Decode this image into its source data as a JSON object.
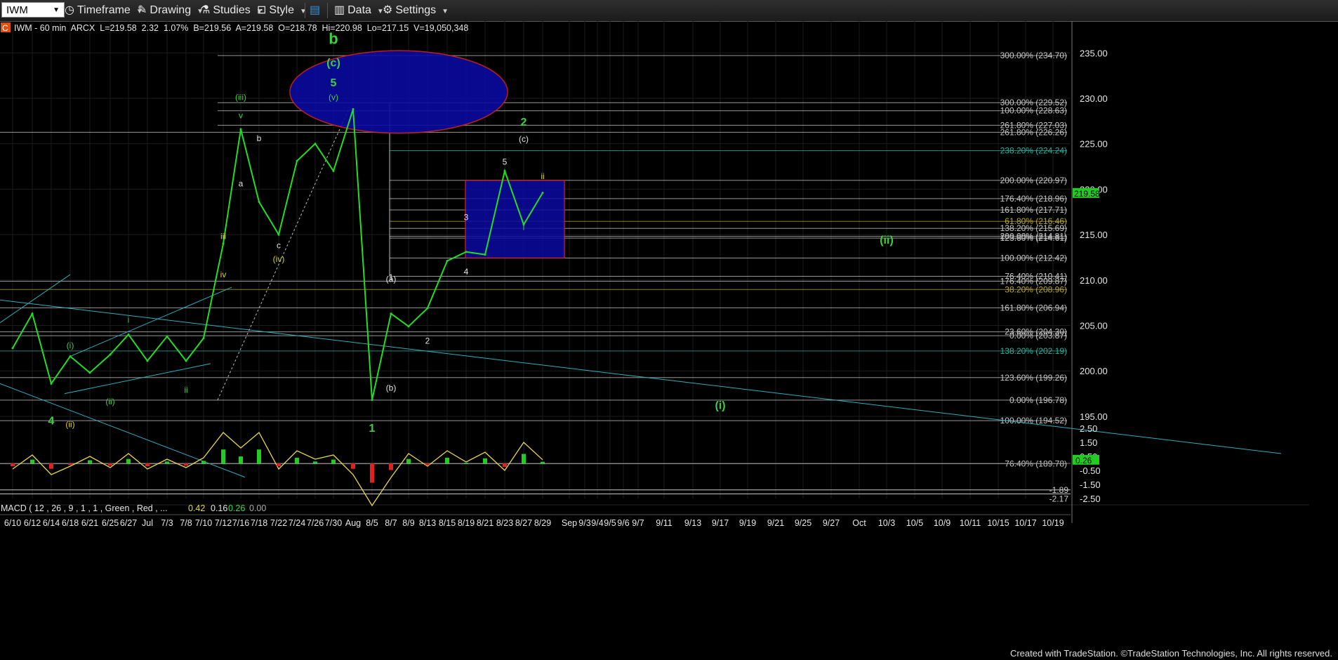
{
  "toolbar": {
    "symbol": "IWM",
    "timeframe": "Timeframe",
    "drawing": "Drawing",
    "studies": "Studies",
    "style": "Style",
    "data": "Data",
    "settings": "Settings"
  },
  "header": {
    "badge": "C",
    "info": "IWM - 60 min  ARCX  L=219.58  2.32  1.07%  B=219.56  A=219.58  O=218.78  Hi=220.98  Lo=217.15  V=19,050,348"
  },
  "macd_header": {
    "label": "MACD ( 12 , 26 , 9 , 1 , 1 , Green , Red , ...",
    "v1": "0.42",
    "v2": "0.16",
    "v3": "0.26",
    "v4": "0.00"
  },
  "footer": "Created with TradeStation. ©TradeStation Technologies, Inc. All rights reserved.",
  "colors": {
    "bg": "#000000",
    "price_line": "#22dd22",
    "wave_green": "#3ecf3e",
    "wave_yellow": "#d8d02a",
    "channel": "#2ab0c0",
    "box": "#0a0aa0",
    "box_border": "#cc2222"
  },
  "chart_data": {
    "type": "line",
    "symbol": "IWM",
    "interval": "60 min",
    "x_ticks": [
      "6/10",
      "6/12",
      "6/14",
      "6/18",
      "6/21",
      "6/25",
      "6/27",
      "Jul",
      "7/3",
      "7/8",
      "7/10",
      "7/12",
      "7/16",
      "7/18",
      "7/22",
      "7/24",
      "7/26",
      "7/30",
      "Aug",
      "8/5",
      "8/7",
      "8/9",
      "8/13",
      "8/15",
      "8/19",
      "8/21",
      "8/23",
      "8/27",
      "8/29",
      "Sep",
      "9/3",
      "9/4",
      "9/5",
      "9/6",
      "9/7",
      "9/11",
      "9/13",
      "9/17",
      "9/19",
      "9/21",
      "9/25",
      "9/27",
      "Oct",
      "10/3",
      "10/5",
      "10/9",
      "10/11",
      "10/15",
      "10/17",
      "10/19"
    ],
    "y_ticks": [
      195,
      200,
      205,
      210,
      215,
      220,
      225,
      230,
      235
    ],
    "ylim": [
      187.5,
      238.5
    ],
    "last_price": "219.58",
    "price_series": [
      {
        "x": "6/10",
        "y": 202.5
      },
      {
        "x": "6/12",
        "y": 206.3
      },
      {
        "x": "6/14",
        "y": 198.6
      },
      {
        "x": "6/18",
        "y": 201.6
      },
      {
        "x": "6/21",
        "y": 199.8
      },
      {
        "x": "6/25",
        "y": 201.8
      },
      {
        "x": "6/27",
        "y": 204.0
      },
      {
        "x": "Jul",
        "y": 201.1
      },
      {
        "x": "7/3",
        "y": 203.8
      },
      {
        "x": "7/8",
        "y": 201.1
      },
      {
        "x": "7/10",
        "y": 203.6
      },
      {
        "x": "7/12",
        "y": 214.0
      },
      {
        "x": "7/16",
        "y": 226.6
      },
      {
        "x": "7/18",
        "y": 218.6
      },
      {
        "x": "7/22",
        "y": 215.0
      },
      {
        "x": "7/24",
        "y": 223.1
      },
      {
        "x": "7/26",
        "y": 225.0
      },
      {
        "x": "7/30",
        "y": 222.0
      },
      {
        "x": "Aug",
        "y": 228.8
      },
      {
        "x": "8/5",
        "y": 196.8
      },
      {
        "x": "8/7",
        "y": 206.3
      },
      {
        "x": "8/9",
        "y": 204.9
      },
      {
        "x": "8/13",
        "y": 206.9
      },
      {
        "x": "8/15",
        "y": 212.1
      },
      {
        "x": "8/19",
        "y": 213.1
      },
      {
        "x": "8/21",
        "y": 212.8
      },
      {
        "x": "8/23",
        "y": 222.0
      },
      {
        "x": "8/27",
        "y": 216.1
      },
      {
        "x": "8/29",
        "y": 219.6
      }
    ],
    "fib_levels": [
      {
        "label": "300.00% (234.70)",
        "value": 234.7
      },
      {
        "label": "300.00% (229.52)",
        "value": 229.52
      },
      {
        "label": "100.00% (228.63)",
        "value": 228.63
      },
      {
        "label": "261.80% (227.03)",
        "value": 227.03
      },
      {
        "label": "261.80% (226.26)",
        "value": 226.26
      },
      {
        "label": "238.20% (224.24)",
        "value": 224.24
      },
      {
        "label": "200.00% (220.97)",
        "value": 220.97
      },
      {
        "label": "176.40% (218.96)",
        "value": 218.96
      },
      {
        "label": "161.80% (217.71)",
        "value": 217.71
      },
      {
        "label": "61.80% (216.46)",
        "value": 216.46
      },
      {
        "label": "138.20% (215.69)",
        "value": 215.69
      },
      {
        "label": "200.00% (214.81)",
        "value": 214.81
      },
      {
        "label": "123.60% (214.61)",
        "value": 214.61
      },
      {
        "label": "100.00% (212.42)",
        "value": 212.42
      },
      {
        "label": "76.40% (210.41)",
        "value": 210.41
      },
      {
        "label": "176.40% (209.87)",
        "value": 209.87
      },
      {
        "label": "38.20% (208.96)",
        "value": 208.96
      },
      {
        "label": "161.80% (206.94)",
        "value": 206.94
      },
      {
        "label": "23.60% (204.30)",
        "value": 204.3
      },
      {
        "label": "0.00% (203.87)",
        "value": 203.87
      },
      {
        "label": "138.20% (202.19)",
        "value": 202.19
      },
      {
        "label": "123.60% (199.26)",
        "value": 199.26
      },
      {
        "label": "0.00% (196.78)",
        "value": 196.78
      },
      {
        "label": "100.00% (194.52)",
        "value": 194.52
      },
      {
        "label": "76.40% (189.78)",
        "value": 189.78
      }
    ],
    "wave_labels": [
      {
        "text": "b",
        "x": "7/30",
        "y": 236.0,
        "color": "green",
        "size": "xl"
      },
      {
        "text": "(c)",
        "x": "7/30",
        "y": 233.5,
        "color": "green",
        "size": "l"
      },
      {
        "text": "5",
        "x": "7/30",
        "y": 231.3,
        "color": "green",
        "size": "l"
      },
      {
        "text": "(v)",
        "x": "7/30",
        "y": 229.8,
        "color": "green",
        "size": "s"
      },
      {
        "text": "(iii)",
        "x": "7/16",
        "y": 229.8,
        "color": "green",
        "size": "s"
      },
      {
        "text": "v",
        "x": "7/16",
        "y": 227.8,
        "color": "green",
        "size": "s"
      },
      {
        "text": "b",
        "x": "7/18",
        "y": 225.3,
        "color": "white",
        "size": "s"
      },
      {
        "text": "a",
        "x": "7/16",
        "y": 220.3,
        "color": "white",
        "size": "s"
      },
      {
        "text": "c",
        "x": "7/22",
        "y": 213.5,
        "color": "white",
        "size": "s"
      },
      {
        "text": "(iv)",
        "x": "7/22",
        "y": 212.0,
        "color": "yellow",
        "size": "s"
      },
      {
        "text": "iii",
        "x": "7/12",
        "y": 214.5,
        "color": "yellow",
        "size": "s"
      },
      {
        "text": "iv",
        "x": "7/12",
        "y": 210.3,
        "color": "yellow",
        "size": "s"
      },
      {
        "text": "(i)",
        "x": "6/18",
        "y": 202.5,
        "color": "green",
        "size": "s"
      },
      {
        "text": "i",
        "x": "6/27",
        "y": 205.3,
        "color": "green",
        "size": "s"
      },
      {
        "text": "(ii)",
        "x": "6/25",
        "y": 196.3,
        "color": "green",
        "size": "s"
      },
      {
        "text": "ii",
        "x": "7/8",
        "y": 197.6,
        "color": "green",
        "size": "s"
      },
      {
        "text": "4",
        "x": "6/14",
        "y": 194.1,
        "color": "green",
        "size": "l"
      },
      {
        "text": "(ii)",
        "x": "6/18",
        "y": 193.8,
        "color": "yellow",
        "size": "s"
      },
      {
        "text": "1",
        "x": "8/5",
        "y": 193.3,
        "color": "green",
        "size": "l"
      },
      {
        "text": "(a)",
        "x": "8/7",
        "y": 209.8,
        "color": "white",
        "size": "s"
      },
      {
        "text": "1",
        "x": "8/7",
        "y": 210.0,
        "color": "white",
        "size": "s"
      },
      {
        "text": "(b)",
        "x": "8/7",
        "y": 197.8,
        "color": "white",
        "size": "s"
      },
      {
        "text": "2",
        "x": "8/13",
        "y": 203.0,
        "color": "white",
        "size": "s"
      },
      {
        "text": "3",
        "x": "8/19",
        "y": 216.6,
        "color": "white",
        "size": "s"
      },
      {
        "text": "4",
        "x": "8/19",
        "y": 210.6,
        "color": "white",
        "size": "s"
      },
      {
        "text": "5",
        "x": "8/23",
        "y": 222.7,
        "color": "white",
        "size": "s"
      },
      {
        "text": "(c)",
        "x": "8/27",
        "y": 225.2,
        "color": "white",
        "size": "s"
      },
      {
        "text": "2",
        "x": "8/27",
        "y": 227.0,
        "color": "green",
        "size": "l"
      },
      {
        "text": "i",
        "x": "8/27",
        "y": 215.5,
        "color": "green",
        "size": "s"
      },
      {
        "text": "ii",
        "x": "8/29",
        "y": 221.1,
        "color": "yellow",
        "size": "s"
      },
      {
        "text": "(ii)",
        "x": "10/3",
        "y": 214.0,
        "color": "green",
        "size": "l"
      },
      {
        "text": "(i)",
        "x": "9/17",
        "y": 195.8,
        "color": "green",
        "size": "l"
      }
    ],
    "macd": {
      "y_ticks": [
        "2.50",
        "1.50",
        "0.50",
        "-0.50",
        "-1.50",
        "-2.50"
      ],
      "ylim": [
        -3.0,
        3.0
      ],
      "last_value": "0.26",
      "right_labels": [
        "-1.89",
        "-2.17"
      ],
      "line_series": [
        {
          "x": "6/10",
          "y": -0.4
        },
        {
          "x": "6/12",
          "y": 0.6
        },
        {
          "x": "6/14",
          "y": -0.8
        },
        {
          "x": "6/18",
          "y": -0.2
        },
        {
          "x": "6/21",
          "y": 0.5
        },
        {
          "x": "6/25",
          "y": -0.3
        },
        {
          "x": "6/27",
          "y": 0.7
        },
        {
          "x": "Jul",
          "y": -0.4
        },
        {
          "x": "7/3",
          "y": 0.3
        },
        {
          "x": "7/8",
          "y": -0.3
        },
        {
          "x": "7/10",
          "y": 0.4
        },
        {
          "x": "7/12",
          "y": 2.2
        },
        {
          "x": "7/16",
          "y": 1.1
        },
        {
          "x": "7/18",
          "y": 2.2
        },
        {
          "x": "7/22",
          "y": -0.4
        },
        {
          "x": "7/24",
          "y": 0.9
        },
        {
          "x": "7/26",
          "y": 0.3
        },
        {
          "x": "7/30",
          "y": 0.6
        },
        {
          "x": "Aug",
          "y": -0.8
        },
        {
          "x": "8/5",
          "y": -3.0
        },
        {
          "x": "8/7",
          "y": -1.0
        },
        {
          "x": "8/9",
          "y": 0.7
        },
        {
          "x": "8/13",
          "y": -0.2
        },
        {
          "x": "8/15",
          "y": 0.9
        },
        {
          "x": "8/19",
          "y": 0.1
        },
        {
          "x": "8/21",
          "y": 0.8
        },
        {
          "x": "8/23",
          "y": -0.5
        },
        {
          "x": "8/27",
          "y": 1.5
        },
        {
          "x": "8/29",
          "y": 0.26
        }
      ]
    }
  }
}
